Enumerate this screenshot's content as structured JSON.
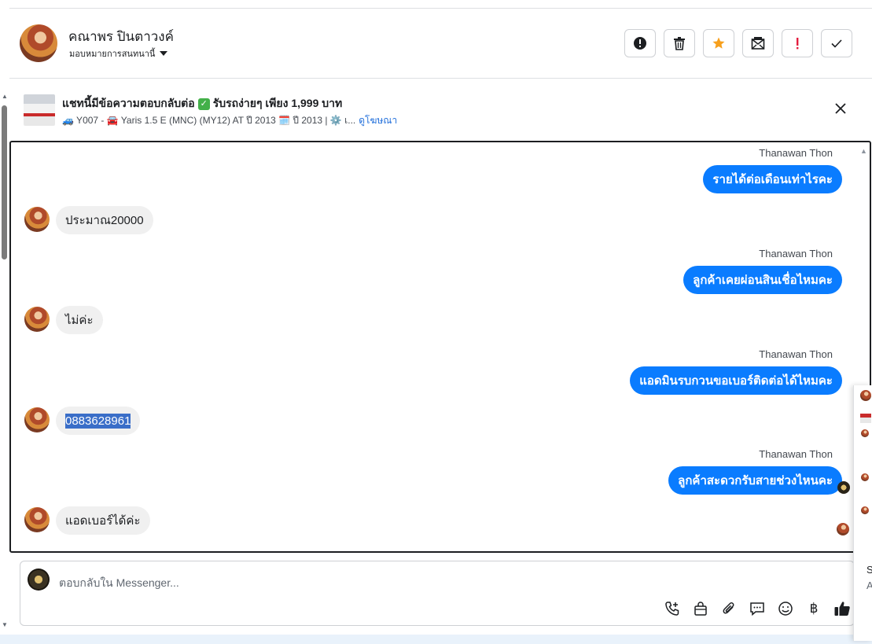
{
  "header": {
    "contact_name": "คณาพร ปินตาวงค์",
    "assign_label": "มอบหมายการสนทนานี้",
    "actions": [
      {
        "name": "report-icon",
        "glyph": "!"
      },
      {
        "name": "trash-icon",
        "glyph": ""
      },
      {
        "name": "star-icon",
        "glyph": "★"
      },
      {
        "name": "mark-unread-icon",
        "glyph": ""
      },
      {
        "name": "spam-icon",
        "glyph": "!"
      },
      {
        "name": "done-check-icon",
        "glyph": "✓"
      }
    ],
    "colors": {
      "star": "#f7a01d",
      "spam": "#e41e3f"
    }
  },
  "ad": {
    "title": "แชทนี้มีข้อความตอบกลับต่อ",
    "title_suffix": "รับรถง่ายๆ เพียง 1,999 บาท",
    "details": "🚙 Y007 - 🚘 Yaris 1.5 E (MNC) (MY12) AT ปี 2013 🗓️ ปี 2013 | ⚙️ เ...",
    "link": "ดูโฆษณา"
  },
  "messages": [
    {
      "direction": "out",
      "sender": "Thanawan Thon",
      "text": "รายได้ต่อเดือนเท่าไรคะ"
    },
    {
      "direction": "in",
      "text": "ประมาณ20000"
    },
    {
      "direction": "out",
      "sender": "Thanawan Thon",
      "text": "ลูกค้าเคยผ่อนสินเชื่อไหมคะ"
    },
    {
      "direction": "in",
      "text": "ไม่ค่ะ"
    },
    {
      "direction": "out",
      "sender": "Thanawan Thon",
      "text": "แอดมินรบกวนขอเบอร์ติดต่อได้ไหมคะ"
    },
    {
      "direction": "in",
      "text": "0883628961",
      "selected": true
    },
    {
      "direction": "out",
      "sender": "Thanawan Thon",
      "text": "ลูกค้าสะดวกรับสายช่วงไหนคะ"
    },
    {
      "direction": "in",
      "text": "แอดเบอร์ได้ค่ะ"
    }
  ],
  "composer": {
    "placeholder": "ตอบกลับใน Messenger...",
    "tools": [
      "call-add-icon",
      "shopping-bag-icon",
      "attachment-icon",
      "saved-replies-icon",
      "emoji-icon",
      "baht-payment-icon",
      "like-icon"
    ],
    "baht_glyph": "฿"
  },
  "side_panel": {
    "text_1": "S",
    "text_2": "A"
  },
  "colors": {
    "outgoing": "#0a7cff",
    "incoming": "#f0f0f0",
    "link": "#216fdb"
  }
}
